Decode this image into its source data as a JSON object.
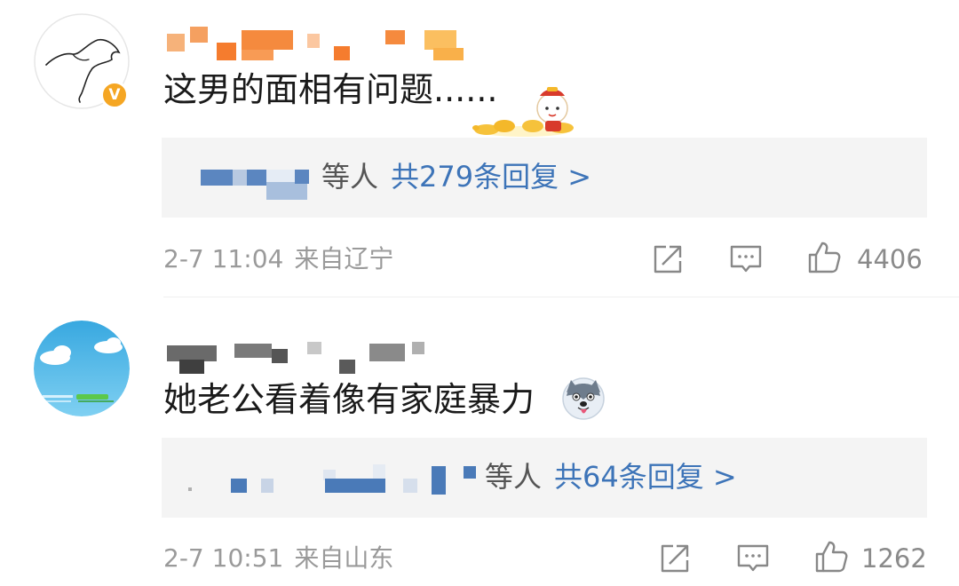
{
  "comments": [
    {
      "text": "这男的面相有问题......",
      "verified_icon": "v-badge-icon",
      "sticker_icon": "gold-ingot-character-sticker",
      "reply_summary": {
        "suffix": "等人",
        "count_text": "共279条回复 >"
      },
      "time": "2-7 11:04",
      "location": "来自辽宁",
      "likes": "4406"
    },
    {
      "text": "她老公看着像有家庭暴力",
      "sticker_icon": "husky-dog-emoji",
      "reply_summary": {
        "suffix": "等人",
        "count_text": "共64条回复 >"
      },
      "time": "2-7 10:51",
      "location": "来自山东",
      "likes": "1262"
    }
  ],
  "icons": {
    "share": "share-icon",
    "comment": "comment-icon",
    "like": "thumbs-up-icon"
  },
  "colors": {
    "reply_link": "#3d74b8",
    "meta_text": "#9a9a9a",
    "reply_bg": "#f4f4f4",
    "verified": "#f5a623"
  }
}
